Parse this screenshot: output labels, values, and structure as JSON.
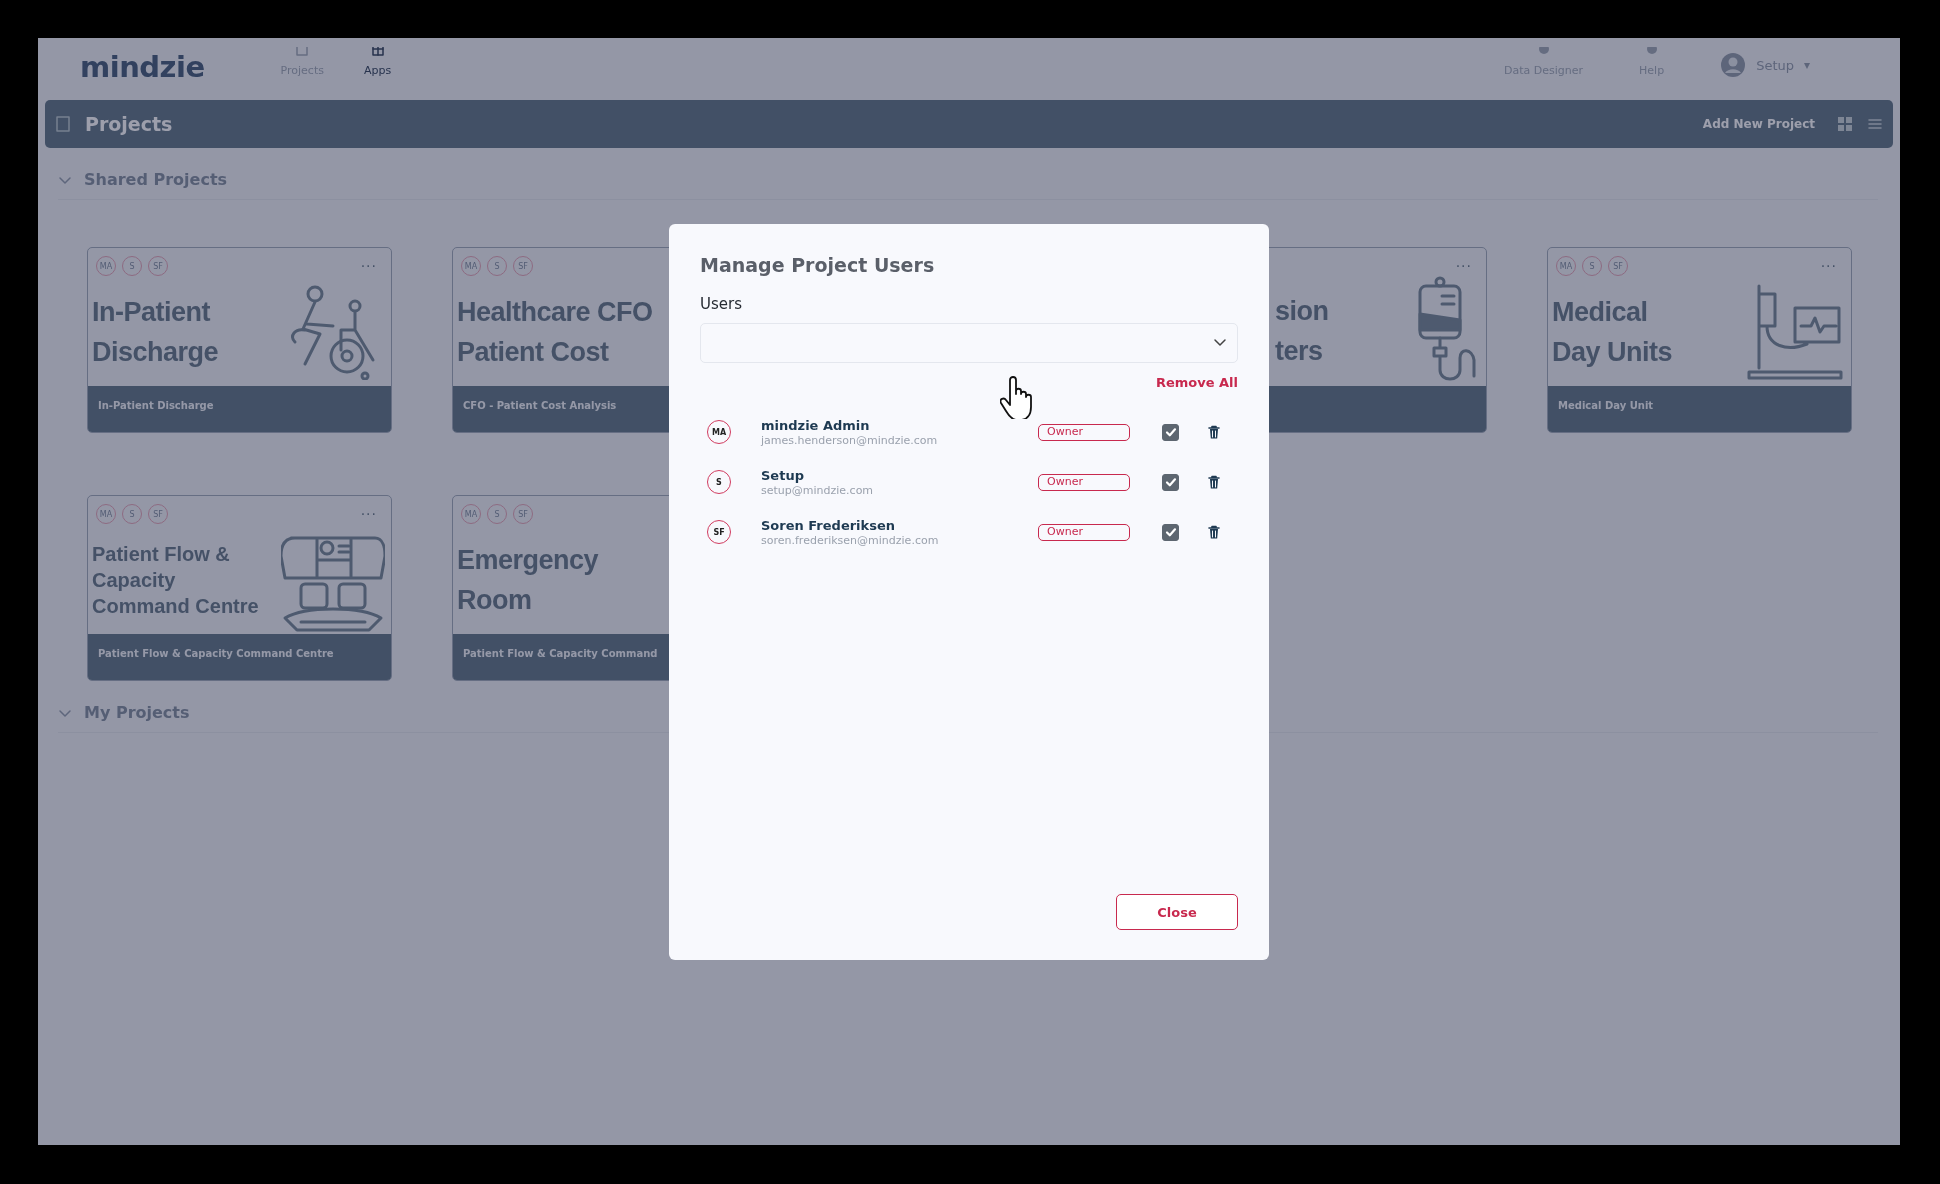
{
  "nav": {
    "logo": "mindzie",
    "items": [
      {
        "label": "Projects",
        "selected": false
      },
      {
        "label": "Apps",
        "selected": true
      }
    ],
    "right_items": [
      {
        "label": "Data Designer"
      },
      {
        "label": "Help"
      }
    ],
    "user": "Setup",
    "user_caret": "▾"
  },
  "header": {
    "title": "Projects",
    "add_button": "Add New Project"
  },
  "sections": [
    {
      "title": "Shared Projects",
      "expanded": true,
      "cards": [
        {
          "avatars": [
            "MA",
            "S",
            "SF"
          ],
          "more": "···",
          "title": [
            "In-Patient",
            "Discharge"
          ],
          "subtitle": "In-Patient Discharge"
        },
        {
          "avatars": [
            "MA",
            "S",
            "SF"
          ],
          "title": [
            "Healthcare CFO",
            "Patient Cost"
          ],
          "subtitle": "CFO - Patient Cost Analysis"
        },
        {
          "more": "···",
          "title": [
            "sion",
            "ters"
          ]
        },
        {
          "avatars": [
            "MA",
            "S",
            "SF"
          ],
          "more": "···",
          "title": [
            "Medical",
            "Day Units"
          ],
          "subtitle": "Medical Day Unit"
        },
        {
          "avatars": [
            "MA",
            "S",
            "SF"
          ],
          "more": "···",
          "title": [
            "Patient Flow &",
            "Capacity",
            "Command Centre"
          ],
          "subtitle": "Patient Flow & Capacity Command Centre",
          "small": true
        },
        {
          "avatars": [
            "MA",
            "S",
            "SF"
          ],
          "title": [
            "Emergency",
            "Room"
          ],
          "subtitle": "Patient Flow & Capacity Command"
        }
      ]
    },
    {
      "title": "My Projects",
      "expanded": true
    }
  ],
  "modal": {
    "title": "Manage Project Users",
    "field_label": "Users",
    "remove_all": "Remove All",
    "users": [
      {
        "initials": "MA",
        "name": "mindzie Admin",
        "email": "james.henderson@mindzie.com",
        "role": "Owner",
        "checked": true
      },
      {
        "initials": "S",
        "name": "Setup",
        "email": "setup@mindzie.com",
        "role": "Owner",
        "checked": true
      },
      {
        "initials": "SF",
        "name": "Soren Frederiksen",
        "email": "soren.frederiksen@mindzie.com",
        "role": "Owner",
        "checked": true
      }
    ],
    "close": "Close"
  }
}
